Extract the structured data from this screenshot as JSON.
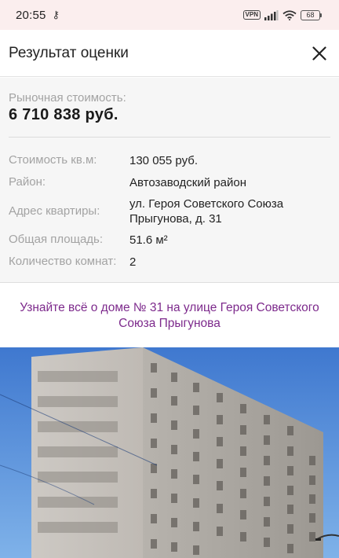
{
  "status_bar": {
    "time": "20:55",
    "key_symbol": "⚷",
    "vpn": "VPN",
    "battery": "68"
  },
  "header": {
    "title": "Результат оценки",
    "close_icon": "close-icon"
  },
  "valuation": {
    "price_label": "Рыночная стоимость:",
    "price_value": "6 710 838 руб.",
    "details": [
      {
        "label": "Стоимость кв.м:",
        "value": "130 055 руб."
      },
      {
        "label": "Район:",
        "value": "Автозаводский район"
      },
      {
        "label": "Адрес квартиры:",
        "value": "ул. Героя Советского Союза Прыгунова, д. 31"
      },
      {
        "label": "Общая площадь:",
        "value": "51.6 м²"
      },
      {
        "label": "Количество комнат:",
        "value": "2"
      }
    ]
  },
  "house_link": {
    "text": "Узнайте всё о доме № 31 на улице Героя Советского Союза Прыгунова"
  },
  "colors": {
    "accent_link": "#7d2a8c",
    "label_gray": "#a3a3a3",
    "status_bar_bg": "#fbeeee",
    "panel_bg": "#f6f6f6"
  }
}
